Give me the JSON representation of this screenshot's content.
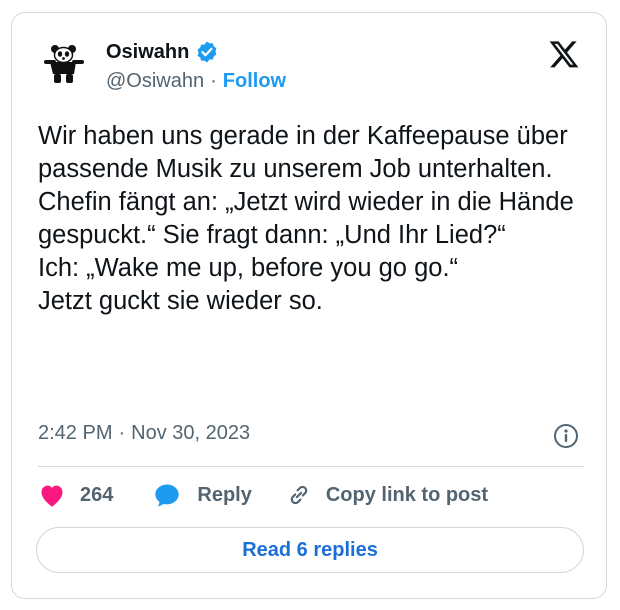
{
  "author": {
    "display_name": "Osiwahn",
    "handle": "@Osiwahn",
    "follow_label": "Follow",
    "separator": "·"
  },
  "tweet": {
    "text": "Wir haben uns gerade in der Kaffeepause über passende Musik zu unserem Job unterhalten.\nChefin fängt an: „Jetzt wird wieder in die Hände gespuckt.“ Sie fragt dann: „Und Ihr Lied?“\nIch: „Wake me up, before you go go.“\nJetzt guckt sie wieder so.",
    "time": "2:42 PM",
    "separator": "·",
    "date": "Nov 30, 2023"
  },
  "actions": {
    "like_count": "264",
    "reply_label": "Reply",
    "copy_link_label": "Copy link to post"
  },
  "read_replies_label": "Read 6 replies",
  "icons": {
    "verified": "verified-badge-icon",
    "x_logo": "x-logo-icon",
    "info": "info-icon",
    "like": "heart-icon",
    "reply": "speech-bubble-icon",
    "copy": "link-icon"
  },
  "colors": {
    "accent": "#1d9bf0",
    "like": "#f91880",
    "text": "#0f1419",
    "muted": "#536471",
    "border": "#cfd9de"
  }
}
